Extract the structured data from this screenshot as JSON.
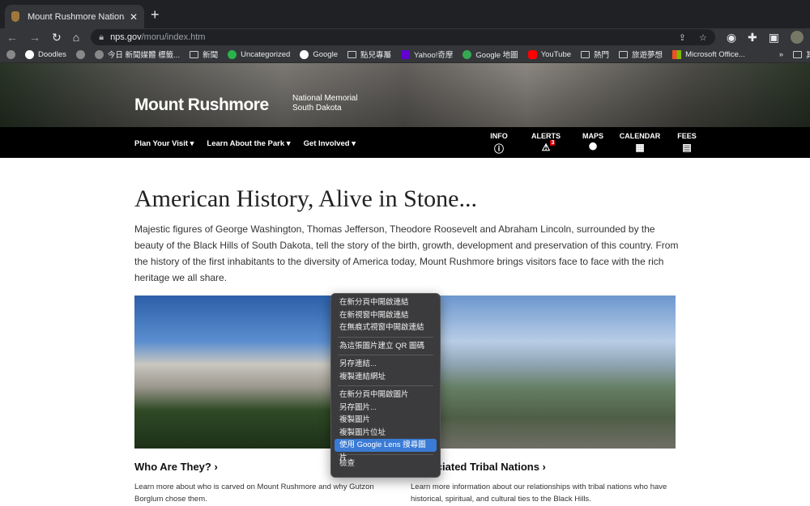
{
  "browser": {
    "tab_title": "Mount Rushmore National Memorial",
    "url_host": "nps.gov",
    "url_path": "/moru/index.htm",
    "bookmarks": [
      {
        "label": "Doodles",
        "icon": "google"
      },
      {
        "label": "",
        "icon": "globe"
      },
      {
        "label": "今日 新聞媒體 標籤...",
        "icon": "globe"
      },
      {
        "label": "新聞",
        "icon": "folder"
      },
      {
        "label": "Uncategorized",
        "icon": "feedly"
      },
      {
        "label": "Google",
        "icon": "google"
      },
      {
        "label": "點兒專屬",
        "icon": "folder"
      },
      {
        "label": "Yahoo!奇摩",
        "icon": "yahoo"
      },
      {
        "label": "Google 地圖",
        "icon": "maps"
      },
      {
        "label": "YouTube",
        "icon": "youtube"
      },
      {
        "label": "熱門",
        "icon": "folder"
      },
      {
        "label": "旅遊夢想",
        "icon": "folder"
      },
      {
        "label": "Microsoft Office...",
        "icon": "microsoft"
      }
    ],
    "bookmarks_more": "»",
    "other_bookmarks": "其他"
  },
  "header": {
    "park_name": "Mount Rushmore",
    "designation": "National Memorial",
    "state": "South Dakota"
  },
  "nav": {
    "menus": [
      "Plan Your Visit",
      "Learn About the Park",
      "Get Involved"
    ],
    "icons": [
      {
        "label": "INFO",
        "glyph": "ⓘ"
      },
      {
        "label": "ALERTS",
        "glyph": "⚠",
        "badge": "3"
      },
      {
        "label": "MAPS",
        "glyph": "⬤"
      },
      {
        "label": "CALENDAR",
        "glyph": "▦"
      },
      {
        "label": "FEES",
        "glyph": "▤"
      }
    ]
  },
  "main": {
    "title": "American History, Alive in Stone...",
    "intro": "Majestic figures of George Washington, Thomas Jefferson, Theodore Roosevelt and Abraham Lincoln, surrounded by the beauty of the Black Hills of South Dakota, tell the story of the birth, growth, development and preservation of this country. From the history of the first inhabitants to the diversity of America today, Mount Rushmore brings visitors face to face with the rich heritage we all share.",
    "cards": [
      {
        "title": "Who Are They? ›",
        "text": "Learn more about who is carved on Mount Rushmore and why Gutzon Borglum chose them."
      },
      {
        "title": "Associated Tribal Nations ›",
        "text": "Learn more information about our relationships with tribal nations who have historical, spiritual, and cultural ties to the Black Hills."
      }
    ]
  },
  "context_menu": {
    "groups": [
      [
        "在新分頁中開啟連結",
        "在新視窗中開啟連結",
        "在無痕式視窗中開啟連結"
      ],
      [
        "為這張圖片建立 QR 圖碼"
      ],
      [
        "另存連結...",
        "複製連結網址"
      ],
      [
        "在新分頁中開啟圖片",
        "另存圖片...",
        "複製圖片",
        "複製圖片位址",
        "使用 Google Lens 搜尋圖片"
      ],
      [
        "檢查"
      ]
    ],
    "highlighted": "使用 Google Lens 搜尋圖片"
  }
}
